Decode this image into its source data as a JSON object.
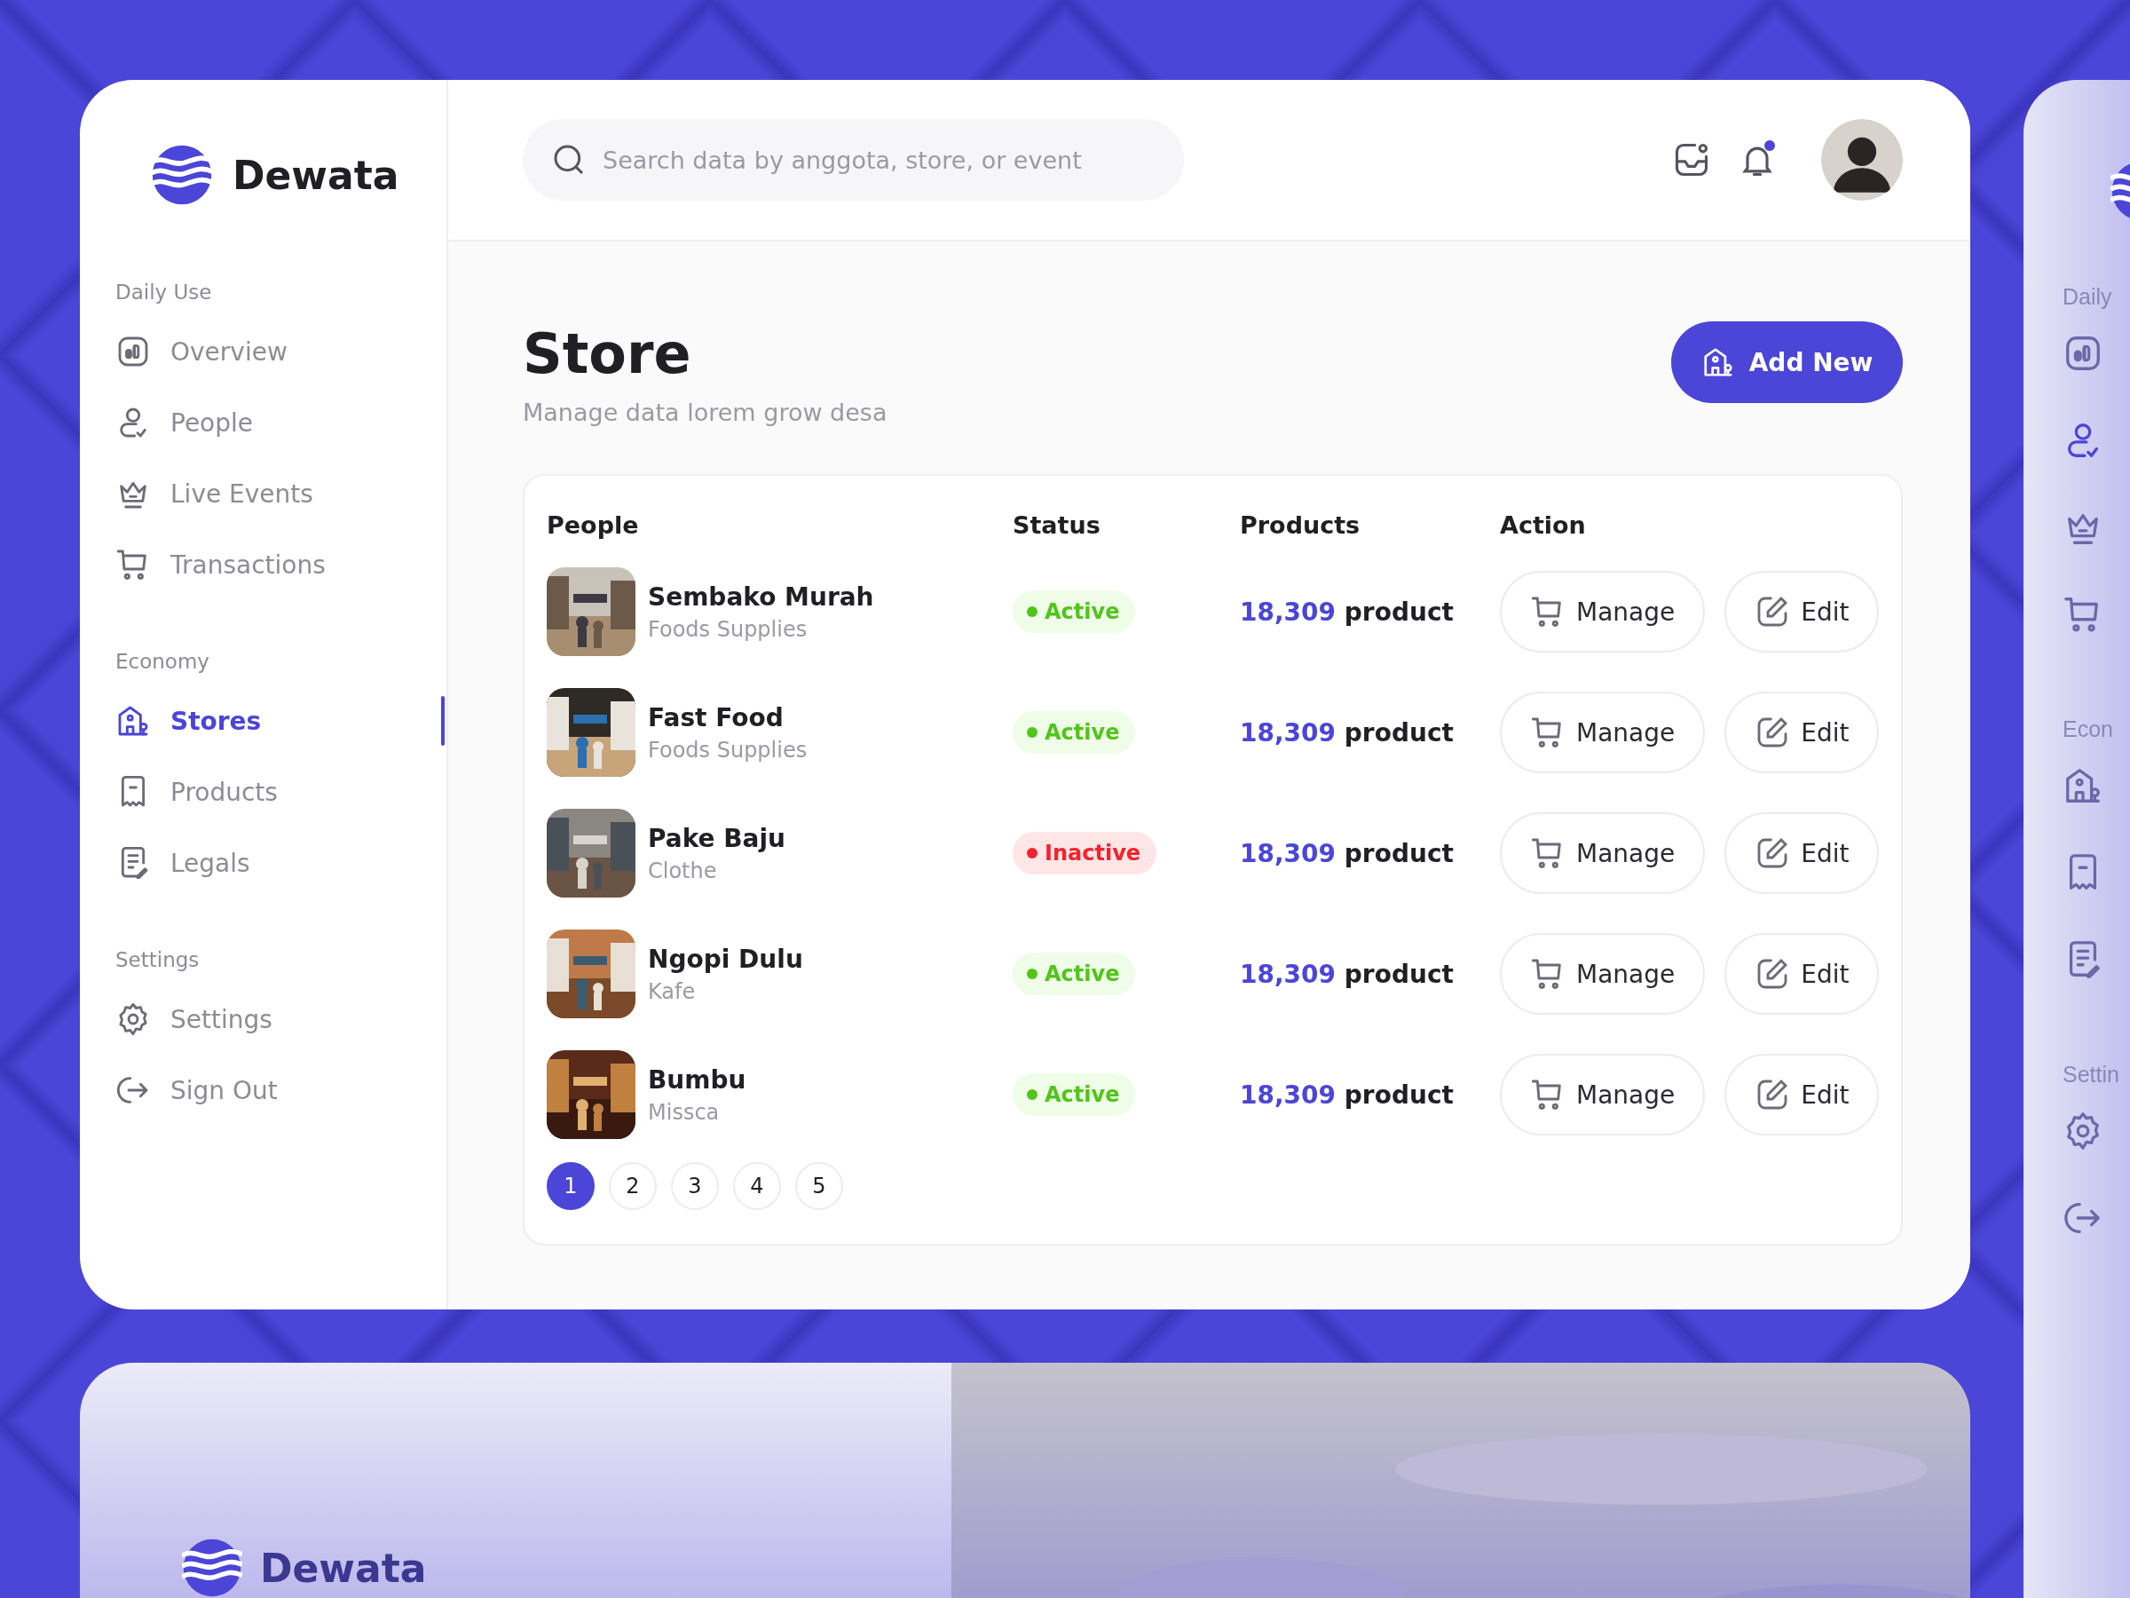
{
  "brand": {
    "name": "Dewata"
  },
  "search": {
    "placeholder": "Search data by anggota, store, or event"
  },
  "header": {
    "notification_dot": true
  },
  "sidebar": {
    "sections": [
      {
        "label": "Daily Use",
        "items": [
          {
            "label": "Overview",
            "kind": "chart",
            "selected": false
          },
          {
            "label": "People",
            "kind": "person",
            "selected": false
          },
          {
            "label": "Live Events",
            "kind": "crown",
            "selected": false
          },
          {
            "label": "Transactions",
            "kind": "cart",
            "selected": false
          }
        ]
      },
      {
        "label": "Economy",
        "items": [
          {
            "label": "Stores",
            "kind": "store",
            "selected": true
          },
          {
            "label": "Products",
            "kind": "receipt",
            "selected": false
          },
          {
            "label": "Legals",
            "kind": "document",
            "selected": false
          }
        ]
      },
      {
        "label": "Settings",
        "items": [
          {
            "label": "Settings",
            "kind": "gear",
            "selected": false
          },
          {
            "label": "Sign Out",
            "kind": "signout",
            "selected": false
          }
        ]
      }
    ]
  },
  "page": {
    "title": "Store",
    "subtitle": "Manage data lorem grow desa",
    "add_button": "Add New"
  },
  "table": {
    "columns": [
      "People",
      "Status",
      "Products",
      "Action"
    ],
    "rows": [
      {
        "name": "Sembako Murah",
        "category": "Foods Supplies",
        "status": {
          "label": "Active",
          "kind": "active"
        },
        "count": "18,309",
        "unit": "product",
        "manage": "Manage",
        "edit": "Edit"
      },
      {
        "name": "Fast Food",
        "category": "Foods Supplies",
        "status": {
          "label": "Active",
          "kind": "active"
        },
        "count": "18,309",
        "unit": "product",
        "manage": "Manage",
        "edit": "Edit"
      },
      {
        "name": "Pake Baju",
        "category": "Clothe",
        "status": {
          "label": "Inactive",
          "kind": "inactive"
        },
        "count": "18,309",
        "unit": "product",
        "manage": "Manage",
        "edit": "Edit"
      },
      {
        "name": "Ngopi Dulu",
        "category": "Kafe",
        "status": {
          "label": "Active",
          "kind": "active"
        },
        "count": "18,309",
        "unit": "product",
        "manage": "Manage",
        "edit": "Edit"
      },
      {
        "name": "Bumbu",
        "category": "Missca",
        "status": {
          "label": "Active",
          "kind": "active"
        },
        "count": "18,309",
        "unit": "product",
        "manage": "Manage",
        "edit": "Edit"
      }
    ],
    "pages": [
      {
        "label": "1",
        "selected": true
      },
      {
        "label": "2",
        "selected": false
      },
      {
        "label": "3",
        "selected": false
      },
      {
        "label": "4",
        "selected": false
      },
      {
        "label": "5",
        "selected": false
      }
    ]
  },
  "peek_sidebar": {
    "sections": [
      {
        "label": "Daily",
        "items": [
          {
            "kind": "chart",
            "selected": false
          },
          {
            "kind": "person",
            "selected": true
          },
          {
            "kind": "crown",
            "selected": false
          },
          {
            "kind": "cart",
            "selected": false
          }
        ]
      },
      {
        "label": "Econ",
        "items": [
          {
            "kind": "store",
            "selected": false
          },
          {
            "kind": "receipt",
            "selected": false
          },
          {
            "kind": "document",
            "selected": false
          }
        ]
      },
      {
        "label": "Settin",
        "items": [
          {
            "kind": "gear",
            "selected": false
          },
          {
            "kind": "signout",
            "selected": false
          }
        ]
      }
    ]
  },
  "bottom_card": {
    "brand": "Dewata"
  }
}
